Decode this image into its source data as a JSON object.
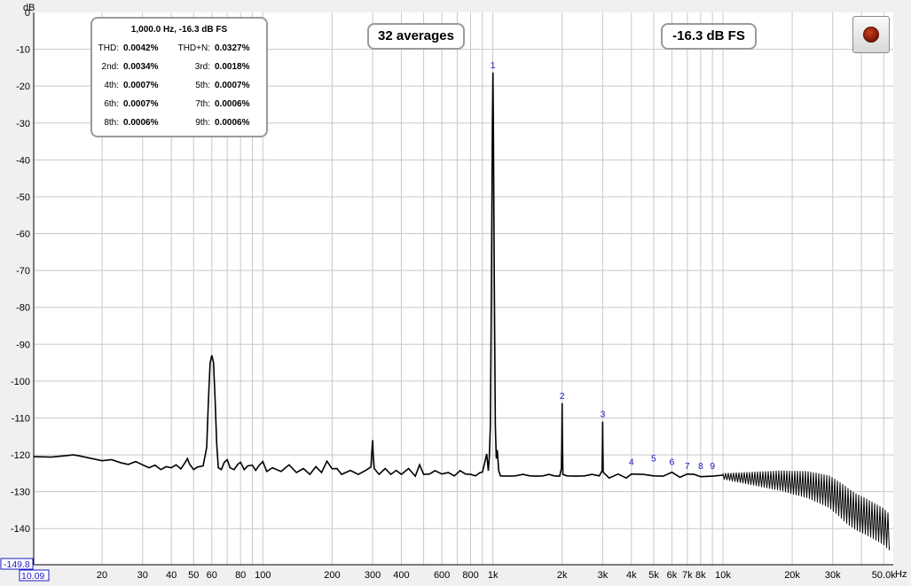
{
  "header": {
    "unit_label": "dB",
    "freq_unit": "Hz",
    "y_min_label": "-149.8",
    "x_min_label": "10.09"
  },
  "readouts": {
    "title": "1,000.0 Hz, -16.3 dB FS",
    "stats": [
      {
        "label": "THD:",
        "value": "0.0042%"
      },
      {
        "label": "THD+N:",
        "value": "0.0327%"
      },
      {
        "label": "2nd:",
        "value": "0.0034%"
      },
      {
        "label": "3rd:",
        "value": "0.0018%"
      },
      {
        "label": "4th:",
        "value": "0.0007%"
      },
      {
        "label": "5th:",
        "value": "0.0007%"
      },
      {
        "label": "6th:",
        "value": "0.0007%"
      },
      {
        "label": "7th:",
        "value": "0.0006%"
      },
      {
        "label": "8th:",
        "value": "0.0006%"
      },
      {
        "label": "9th:",
        "value": "0.0006%"
      }
    ],
    "averages": "32 averages",
    "level": "-16.3 dB FS"
  },
  "controls": {
    "record_icon": "record-icon"
  },
  "colors": {
    "plot_bg": "#ffffff",
    "grid": "#c8c8c8",
    "trace": "#000000",
    "marker_text": "#1a1ac8",
    "frame": "#1a1ac8"
  },
  "chart_data": {
    "type": "line",
    "x_scale": "log",
    "xlim": [
      10.09,
      55000
    ],
    "ylim": [
      -149.8,
      0
    ],
    "ylabel": "dB",
    "xlabel": "Hz",
    "grid": true,
    "y_ticks": [
      0,
      -10,
      -20,
      -30,
      -40,
      -50,
      -60,
      -70,
      -80,
      -90,
      -100,
      -110,
      -120,
      -130,
      -140
    ],
    "y_tick_labels": [
      "0",
      "-10",
      "-20",
      "-30",
      "-40",
      "-50",
      "-60",
      "-70",
      "-80",
      "-90",
      "-100",
      "-110",
      "-120",
      "-130",
      "-140"
    ],
    "x_ticks": [
      20,
      30,
      40,
      50,
      60,
      80,
      100,
      200,
      300,
      400,
      600,
      800,
      1000,
      2000,
      3000,
      4000,
      5000,
      6000,
      7000,
      8000,
      10000,
      20000,
      30000,
      50000
    ],
    "x_tick_labels": [
      "20",
      "30",
      "40",
      "50",
      "60",
      "80",
      "100",
      "200",
      "300",
      "400",
      "600",
      "800",
      "1k",
      "2k",
      "3k",
      "4k",
      "5k",
      "6k",
      "7k",
      "8k",
      "10k",
      "20k",
      "30k",
      "50.0k"
    ],
    "harmonic_markers": [
      {
        "label": "1",
        "freq": 1000,
        "level": -16.3
      },
      {
        "label": "2",
        "freq": 2000,
        "level": -106.0
      },
      {
        "label": "3",
        "freq": 3000,
        "level": -111.0
      },
      {
        "label": "4",
        "freq": 4000,
        "level": -124.0
      },
      {
        "label": "5",
        "freq": 5000,
        "level": -123.0
      },
      {
        "label": "6",
        "freq": 6000,
        "level": -124.0
      },
      {
        "label": "7",
        "freq": 7000,
        "level": -125.0
      },
      {
        "label": "8",
        "freq": 8000,
        "level": -125.0
      },
      {
        "label": "9",
        "freq": 9000,
        "level": -125.0
      }
    ],
    "series": [
      {
        "points": [
          [
            10.09,
            -120.5
          ],
          [
            12,
            -120.6
          ],
          [
            14,
            -120.2
          ],
          [
            15,
            -120.0
          ],
          [
            16,
            -120.3
          ],
          [
            18,
            -121.0
          ],
          [
            20,
            -121.6
          ],
          [
            22,
            -121.3
          ],
          [
            24,
            -122.1
          ],
          [
            26,
            -122.6
          ],
          [
            28,
            -121.8
          ],
          [
            30,
            -122.7
          ],
          [
            32,
            -123.5
          ],
          [
            34,
            -122.8
          ],
          [
            36,
            -124.0
          ],
          [
            38,
            -123.2
          ],
          [
            40,
            -123.5
          ],
          [
            42,
            -122.7
          ],
          [
            44,
            -123.8
          ],
          [
            46,
            -122.0
          ],
          [
            47,
            -121.0
          ],
          [
            48,
            -122.5
          ],
          [
            50,
            -124.0
          ],
          [
            52,
            -123.3
          ],
          [
            55,
            -123.0
          ],
          [
            57,
            -118.0
          ],
          [
            58,
            -105.0
          ],
          [
            59,
            -95.0
          ],
          [
            60,
            -93.0
          ],
          [
            61,
            -95.0
          ],
          [
            62,
            -105.0
          ],
          [
            63,
            -117.0
          ],
          [
            64,
            -123.5
          ],
          [
            66,
            -124.0
          ],
          [
            68,
            -122.0
          ],
          [
            70,
            -121.3
          ],
          [
            72,
            -123.5
          ],
          [
            75,
            -124.0
          ],
          [
            78,
            -122.5
          ],
          [
            80,
            -122.0
          ],
          [
            83,
            -124.0
          ],
          [
            86,
            -123.0
          ],
          [
            90,
            -122.8
          ],
          [
            93,
            -124.2
          ],
          [
            96,
            -123.0
          ],
          [
            100,
            -121.8
          ],
          [
            104,
            -124.5
          ],
          [
            110,
            -123.5
          ],
          [
            120,
            -124.5
          ],
          [
            130,
            -123.0
          ],
          [
            140,
            -124.5
          ],
          [
            150,
            -124.0
          ],
          [
            160,
            -125.0
          ],
          [
            170,
            -123.5
          ],
          [
            180,
            -124.5
          ],
          [
            190,
            -122.0
          ],
          [
            200,
            -123.5
          ],
          [
            210,
            -124.0
          ],
          [
            220,
            -125.0
          ],
          [
            240,
            -124.5
          ],
          [
            260,
            -125.0
          ],
          [
            280,
            -124.5
          ],
          [
            295,
            -123.0
          ],
          [
            298,
            -119.0
          ],
          [
            300,
            -116.0
          ],
          [
            302,
            -120.0
          ],
          [
            305,
            -124.0
          ],
          [
            320,
            -125.0
          ],
          [
            340,
            -124.0
          ],
          [
            360,
            -125.0
          ],
          [
            380,
            -124.5
          ],
          [
            400,
            -125.0
          ],
          [
            430,
            -124.0
          ],
          [
            460,
            -125.5
          ],
          [
            480,
            -123.0
          ],
          [
            500,
            -125.0
          ],
          [
            530,
            -125.5
          ],
          [
            560,
            -124.0
          ],
          [
            600,
            -125.5
          ],
          [
            640,
            -124.5
          ],
          [
            680,
            -126.0
          ],
          [
            720,
            -124.0
          ],
          [
            760,
            -125.5
          ],
          [
            800,
            -125.0
          ],
          [
            840,
            -126.0
          ],
          [
            880,
            -124.5
          ],
          [
            900,
            -125.0
          ],
          [
            920,
            -122.0
          ],
          [
            940,
            -120.0
          ],
          [
            955,
            -124.0
          ],
          [
            965,
            -121.0
          ],
          [
            975,
            -112.0
          ],
          [
            985,
            -75.0
          ],
          [
            995,
            -30.0
          ],
          [
            1000,
            -16.3
          ],
          [
            1005,
            -30.0
          ],
          [
            1015,
            -75.0
          ],
          [
            1025,
            -112.0
          ],
          [
            1035,
            -121.0
          ],
          [
            1045,
            -119.0
          ],
          [
            1060,
            -124.0
          ],
          [
            1080,
            -126.0
          ],
          [
            1150,
            -125.5
          ],
          [
            1250,
            -126.0
          ],
          [
            1350,
            -125.0
          ],
          [
            1450,
            -126.0
          ],
          [
            1550,
            -125.5
          ],
          [
            1650,
            -126.0
          ],
          [
            1750,
            -125.0
          ],
          [
            1850,
            -126.0
          ],
          [
            1950,
            -125.5
          ],
          [
            1985,
            -124.0
          ],
          [
            1995,
            -115.0
          ],
          [
            2000,
            -106.0
          ],
          [
            2005,
            -115.0
          ],
          [
            2015,
            -125.0
          ],
          [
            2100,
            -126.0
          ],
          [
            2300,
            -125.5
          ],
          [
            2500,
            -126.0
          ],
          [
            2700,
            -125.0
          ],
          [
            2900,
            -126.0
          ],
          [
            2985,
            -124.0
          ],
          [
            2995,
            -117.0
          ],
          [
            3000,
            -111.0
          ],
          [
            3005,
            -117.0
          ],
          [
            3015,
            -125.0
          ],
          [
            3200,
            -126.0
          ],
          [
            3500,
            -125.5
          ],
          [
            3800,
            -126.0
          ],
          [
            4000,
            -125.5
          ],
          [
            4500,
            -125.0
          ],
          [
            5000,
            -126.0
          ],
          [
            5500,
            -125.5
          ],
          [
            6000,
            -125.0
          ],
          [
            6500,
            -125.8
          ],
          [
            7000,
            -125.5
          ],
          [
            7500,
            -125.0
          ],
          [
            8000,
            -126.2
          ],
          [
            9000,
            -125.5
          ],
          [
            10000,
            -125.8
          ],
          [
            12000,
            -126.2
          ],
          [
            14000,
            -126.5
          ],
          [
            16000,
            -126.8
          ],
          [
            18000,
            -127.0
          ],
          [
            20000,
            -127.5
          ],
          [
            23000,
            -128.0
          ],
          [
            26000,
            -129.0
          ],
          [
            29000,
            -130.0
          ],
          [
            32000,
            -132.0
          ],
          [
            35000,
            -134.0
          ],
          [
            38000,
            -135.5
          ],
          [
            41000,
            -136.5
          ],
          [
            44000,
            -137.5
          ],
          [
            47000,
            -138.5
          ],
          [
            50000,
            -139.5
          ],
          [
            53000,
            -141.0
          ]
        ]
      }
    ]
  }
}
